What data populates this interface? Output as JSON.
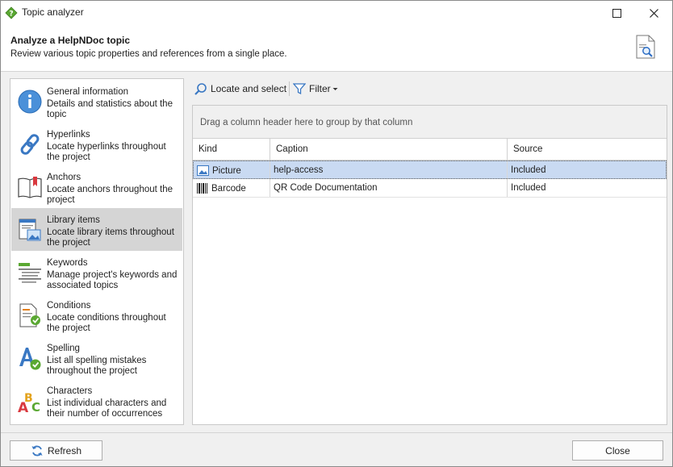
{
  "window": {
    "title": "Topic analyzer"
  },
  "header": {
    "title": "Analyze a HelpNDoc topic",
    "subtitle": "Review various topic properties and references from a single place."
  },
  "nav": {
    "items": [
      {
        "title": "General information",
        "desc": "Details and statistics about the topic",
        "icon": "info-icon",
        "selected": false
      },
      {
        "title": "Hyperlinks",
        "desc": "Locate hyperlinks throughout the project",
        "icon": "chain-link-icon",
        "selected": false
      },
      {
        "title": "Anchors",
        "desc": "Locate anchors throughout the project",
        "icon": "bookmark-book-icon",
        "selected": false
      },
      {
        "title": "Library items",
        "desc": "Locate library items throughout the project",
        "icon": "library-items-icon",
        "selected": true
      },
      {
        "title": "Keywords",
        "desc": "Manage project's keywords and associated topics",
        "icon": "keywords-icon",
        "selected": false
      },
      {
        "title": "Conditions",
        "desc": "Locate conditions throughout the project",
        "icon": "conditions-icon",
        "selected": false
      },
      {
        "title": "Spelling",
        "desc": "List all spelling mistakes throughout the project",
        "icon": "spelling-check-icon",
        "selected": false
      },
      {
        "title": "Characters",
        "desc": "List individual characters and their number of occurrences",
        "icon": "abc-characters-icon",
        "selected": false
      }
    ]
  },
  "toolbar": {
    "locate_label": "Locate and select",
    "filter_label": "Filter"
  },
  "grid": {
    "group_hint": "Drag a column header here to group by that column",
    "columns": [
      "Kind",
      "Caption",
      "Source"
    ],
    "rows": [
      {
        "kind": "Picture",
        "caption": "help-access",
        "source": "Included",
        "icon": "picture-icon",
        "selected": true
      },
      {
        "kind": "Barcode",
        "caption": "QR Code Documentation",
        "source": "Included",
        "icon": "barcode-icon",
        "selected": false
      }
    ]
  },
  "footer": {
    "refresh_label": "Refresh",
    "close_label": "Close"
  },
  "colors": {
    "selection": "#c9daf2",
    "nav_selected": "#d5d5d5",
    "accent": "#2b6cc4"
  }
}
